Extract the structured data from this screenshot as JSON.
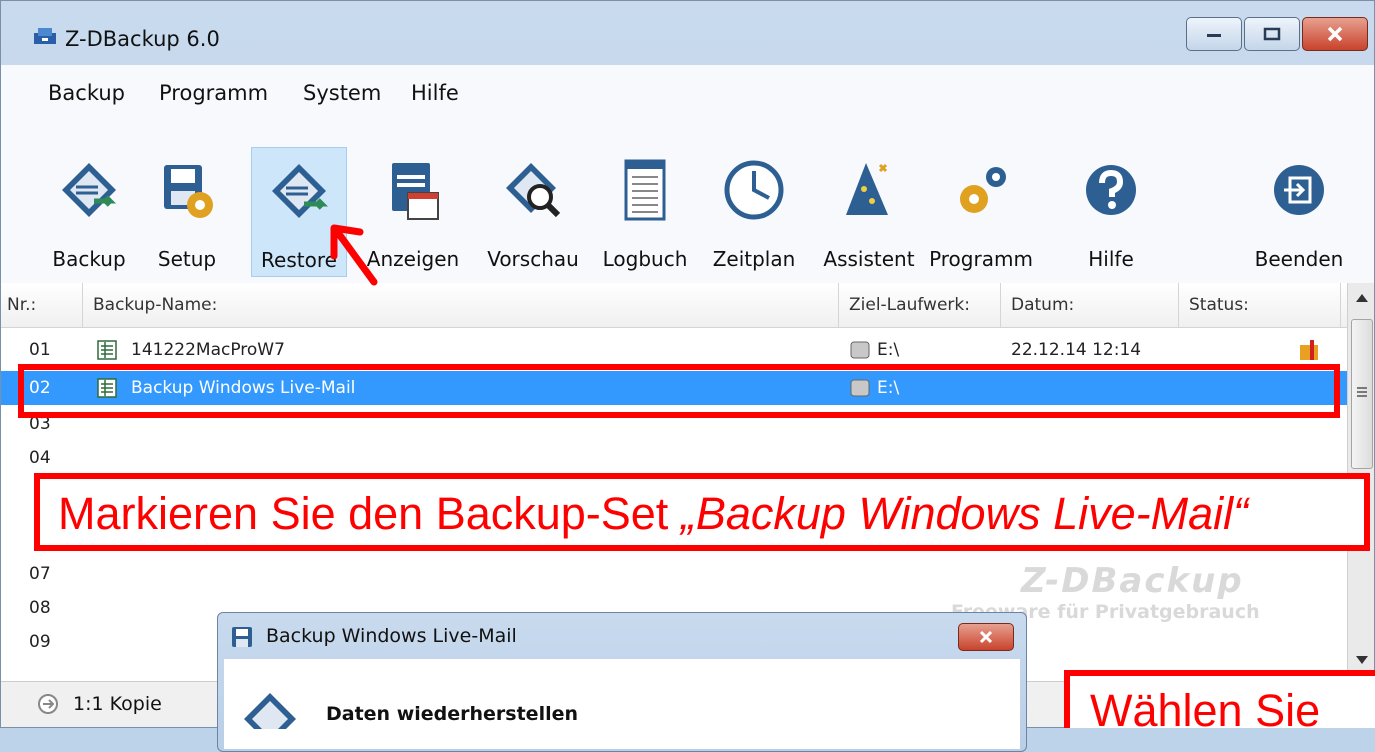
{
  "window": {
    "title": "Z-DBackup 6.0"
  },
  "menu": [
    "Backup",
    "Programm",
    "System",
    "Hilfe"
  ],
  "toolbar": [
    {
      "label": "Backup",
      "icon": "backup-disk-icon"
    },
    {
      "label": "Setup",
      "icon": "setup-disk-gear-icon"
    },
    {
      "label": "Restore",
      "icon": "restore-disk-icon",
      "active": true
    },
    {
      "label": "Anzeigen",
      "icon": "view-window-icon"
    },
    {
      "label": "Vorschau",
      "icon": "preview-magnifier-icon"
    },
    {
      "label": "Logbuch",
      "icon": "logbook-document-icon"
    },
    {
      "label": "Zeitplan",
      "icon": "clock-icon"
    },
    {
      "label": "Assistent",
      "icon": "wizard-icon"
    },
    {
      "label": "Programm",
      "icon": "gears-icon"
    },
    {
      "label": "Hilfe",
      "icon": "help-icon"
    },
    {
      "label": "Beenden",
      "icon": "exit-icon"
    }
  ],
  "table": {
    "columns": [
      "Nr.:",
      "Backup-Name:",
      "Ziel-Laufwerk:",
      "Datum:",
      "Status:"
    ],
    "rows": [
      {
        "nr": "01",
        "name": "141222MacProW7",
        "drive": "E:\\",
        "date": "22.12.14 12:14",
        "status_icon": "box-icon"
      },
      {
        "nr": "02",
        "name": "Backup Windows Live-Mail",
        "drive": "E:\\",
        "date": "",
        "selected": true
      },
      {
        "nr": "03"
      },
      {
        "nr": "04"
      },
      {
        "nr": "07"
      },
      {
        "nr": "08"
      },
      {
        "nr": "09"
      }
    ]
  },
  "watermark": {
    "logo": "Z-DBackup",
    "subtitle": "Freeware für Privatgebrauch"
  },
  "statusbar": {
    "text": "1:1 Kopie"
  },
  "dialog": {
    "title": "Backup Windows Live-Mail",
    "heading": "Daten wiederherstellen"
  },
  "callouts": {
    "main_prefix": "Markieren Sie den Backup-Set ",
    "main_emph": "„Backup Windows Live-Mail“",
    "corner": "Wählen Sie"
  },
  "colors": {
    "selection": "#3399ff",
    "annotation": "#ff0000"
  }
}
